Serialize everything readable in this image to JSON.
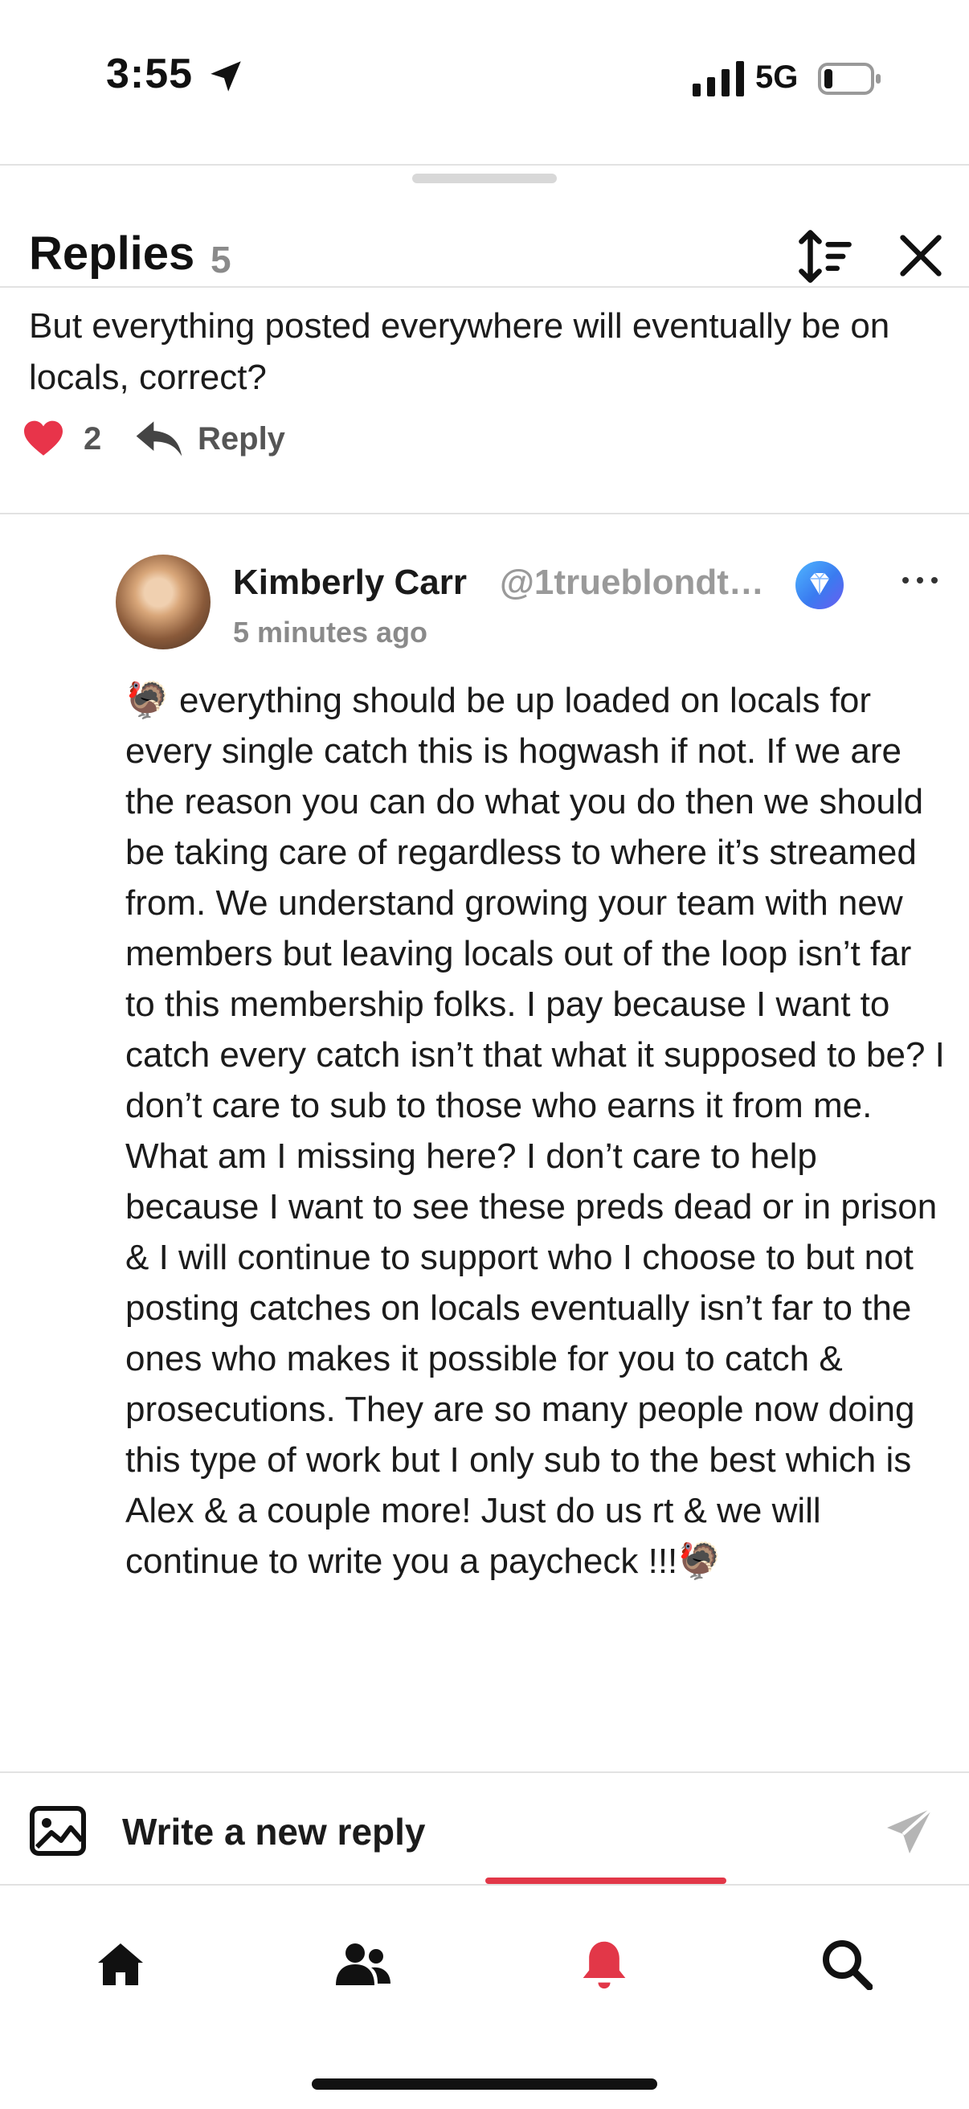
{
  "status_bar": {
    "time": "3:55",
    "network": "5G"
  },
  "header": {
    "title": "Replies",
    "count": "5"
  },
  "parent_reply": {
    "text": "But everything posted everywhere will eventually be on locals, correct?",
    "likes": "2",
    "reply_label": "Reply"
  },
  "comment": {
    "author": "Kimberly Carr",
    "handle": "@1trueblondt…",
    "time_ago": "5 minutes ago",
    "body": "🦃 everything should be up loaded on locals for every single catch this is hogwash if not. If we are the reason you can do what you do then we should be taking care of regardless to where it’s streamed from. We understand growing your team with new members but leaving locals out of the loop isn’t far to this membership folks. I pay because I want to catch every catch isn’t that what it supposed to be? I don’t care to sub to those who earns it from me. What am I missing here? I don’t care to help because I want to see these preds dead or in prison & I will continue to support who I choose to but not posting catches on locals eventually isn’t far to the ones who makes it possible for you to catch & prosecutions. They are so many people now doing this type of work but I only sub to the best which is Alex & a couple more! Just do us rt & we will continue to write you a paycheck !!!🦃"
  },
  "composer": {
    "placeholder": "Write a new reply"
  },
  "tabbar": {
    "active": "notifications"
  },
  "colors": {
    "accent": "#e23748",
    "heart": "#e8344a",
    "muted": "#8a8a8a"
  },
  "icons": [
    "location-arrow-icon",
    "signal-icon",
    "battery-icon",
    "sort-icon",
    "close-icon",
    "heart-icon",
    "reply-arrow-icon",
    "diamond-badge-icon",
    "more-icon",
    "image-icon",
    "send-icon",
    "home-icon",
    "people-icon",
    "bell-icon",
    "search-icon"
  ]
}
